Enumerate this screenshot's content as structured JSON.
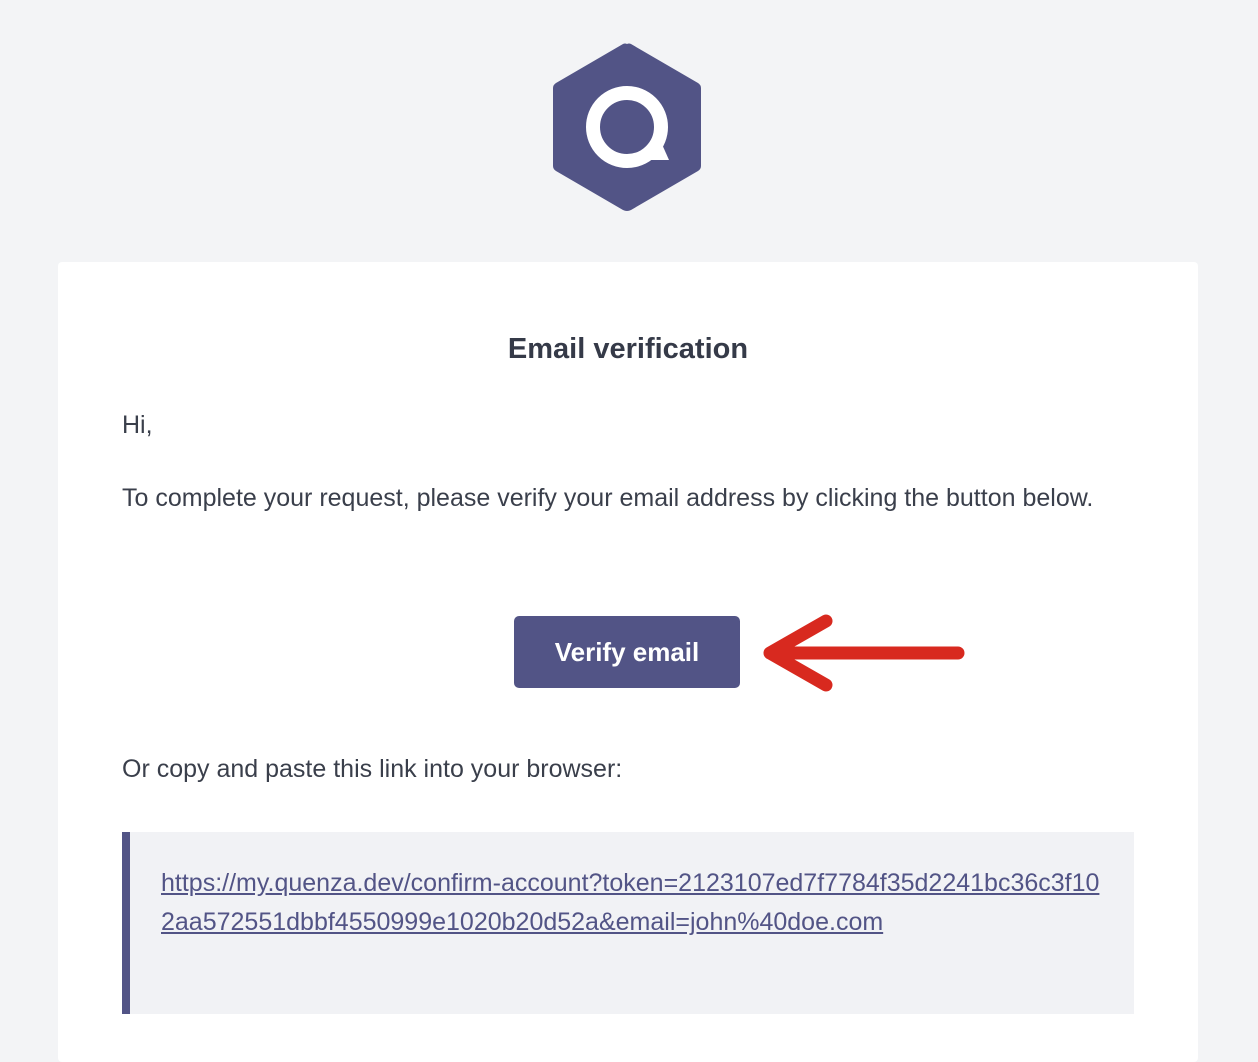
{
  "brand": {
    "logo_letter": "Q",
    "primary_color": "#525486",
    "annotation_arrow_color": "#d8291f"
  },
  "email": {
    "title": "Email verification",
    "greeting": "Hi,",
    "intro": "To complete your request, please verify your email address by clicking the button below.",
    "verify_button_label": "Verify email",
    "copy_hint": "Or copy and paste this link into your browser:",
    "verification_link": "https://my.quenza.dev/confirm-account?token=2123107ed7f7784f35d2241bc36c3f102aa572551dbbf4550999e1020b20d52a&email=john%40doe.com"
  }
}
